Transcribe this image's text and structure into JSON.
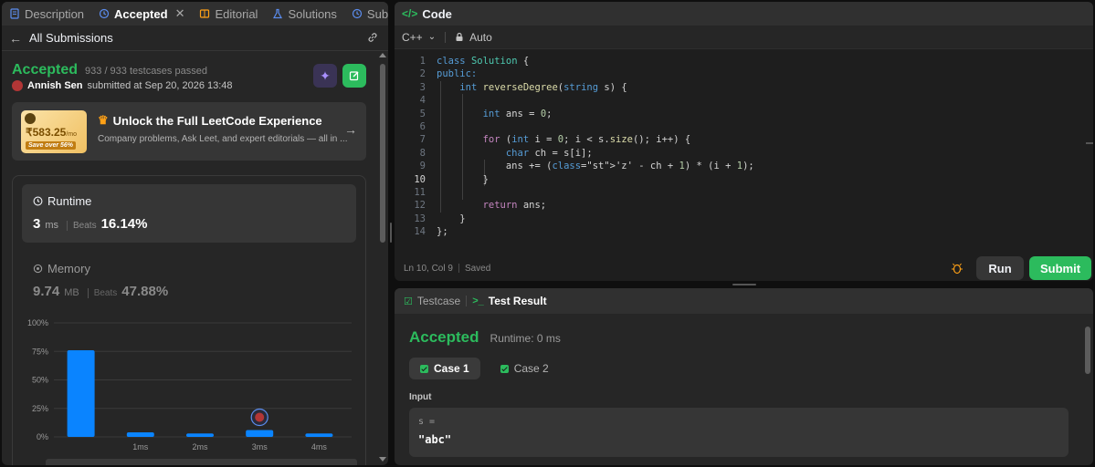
{
  "tabs": [
    {
      "label": "Description",
      "icon": "description-icon"
    },
    {
      "label": "Accepted",
      "icon": "history-icon",
      "active": true,
      "closable": true
    },
    {
      "label": "Editorial",
      "icon": "book-icon"
    },
    {
      "label": "Solutions",
      "icon": "flask-icon"
    },
    {
      "label": "Submissions",
      "icon": "history-icon"
    }
  ],
  "submissions_header": {
    "back_label": "All Submissions"
  },
  "submission": {
    "status": "Accepted",
    "testcases": "933 / 933 testcases passed",
    "author": "Annish Sen",
    "submitted_text": "submitted at Sep 20, 2026 13:48"
  },
  "promo": {
    "price": "₹583.25",
    "per": "/mo",
    "save": "Save over 56%",
    "title": "Unlock the Full LeetCode Experience",
    "subtitle": "Company problems, Ask Leet, and expert editorials — all in ..."
  },
  "runtime": {
    "label": "Runtime",
    "value": "3",
    "unit": "ms",
    "beats_label": "Beats",
    "beats": "16.14%"
  },
  "memory": {
    "label": "Memory",
    "value": "9.74",
    "unit": "MB",
    "beats_label": "Beats",
    "beats": "47.88%"
  },
  "chart_data": {
    "type": "bar",
    "categories": [
      "",
      "1ms",
      "2ms",
      "3ms",
      "4ms"
    ],
    "values": [
      76,
      4,
      3,
      6,
      3
    ],
    "yticks": [
      "100%",
      "75%",
      "50%",
      "25%",
      "0%"
    ],
    "ylim": [
      0,
      100
    ],
    "highlight_category": "3ms",
    "color": "#0a84ff",
    "grid": true
  },
  "code_panel": {
    "title": "Code",
    "language": "C++",
    "auto_label": "Auto",
    "cursor": "Ln 10, Col 9",
    "saved": "Saved",
    "run": "Run",
    "submit": "Submit"
  },
  "code_lines": [
    "class Solution {",
    "public:",
    "    int reverseDegree(string s) {",
    "",
    "        int ans = 0;",
    "",
    "        for (int i = 0; i < s.size(); i++) {",
    "            char ch = s[i];",
    "            ans += ('z' - ch + 1) * (i + 1);",
    "        }",
    "",
    "        return ans;",
    "    }",
    "};"
  ],
  "active_line": 10,
  "test_panel": {
    "tab_testcase": "Testcase",
    "tab_result": "Test Result",
    "status": "Accepted",
    "runtime": "Runtime: 0 ms",
    "cases": [
      "Case 1",
      "Case 2"
    ],
    "input_label": "Input",
    "input_var": "s =",
    "input_value": "\"abc\""
  },
  "colors": {
    "accent_green": "#2cbb5d",
    "bar_blue": "#0a84ff"
  }
}
